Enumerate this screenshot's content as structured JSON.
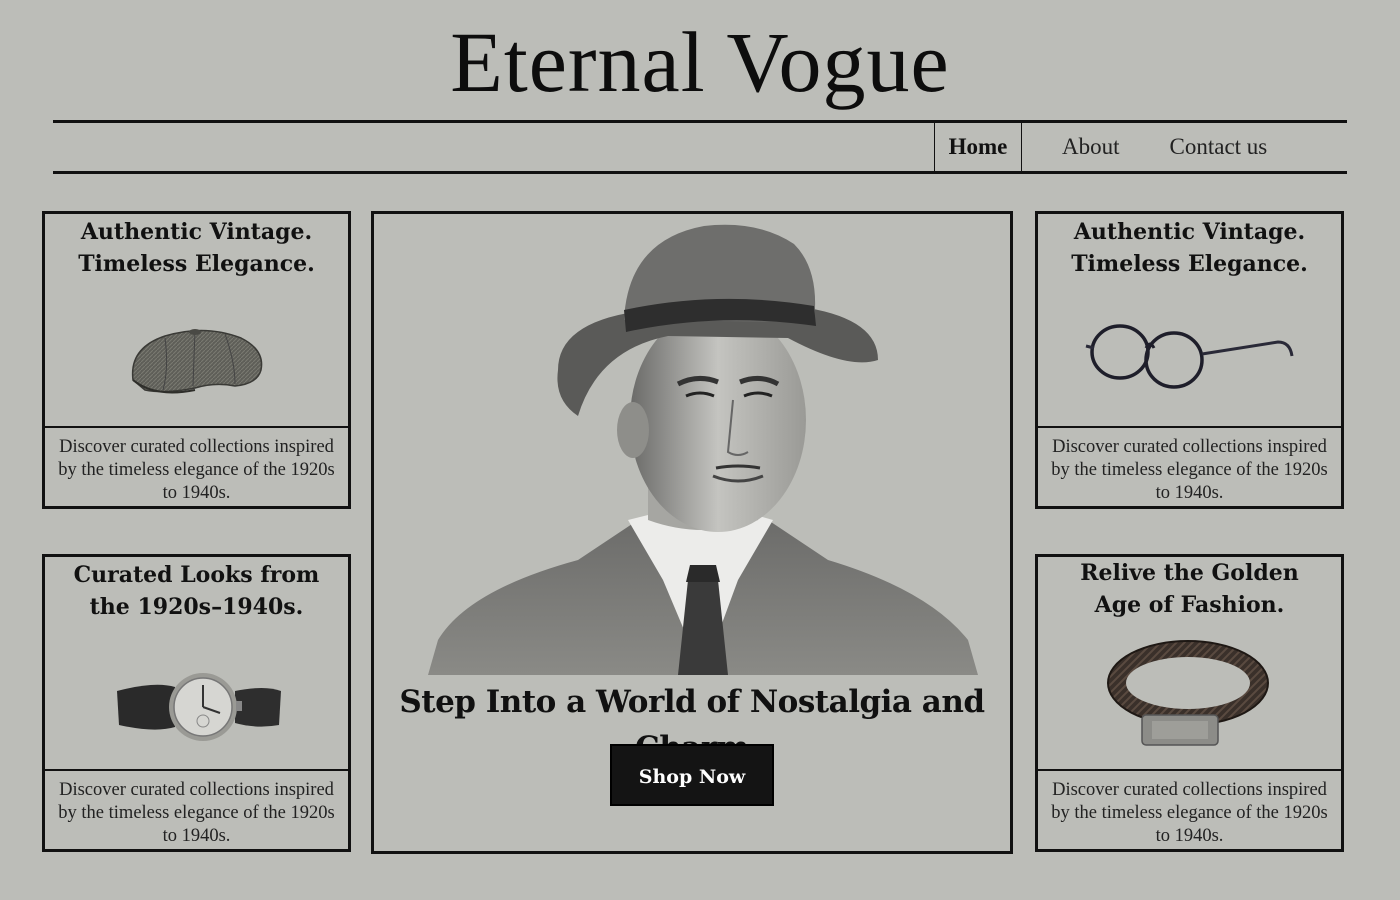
{
  "brand": {
    "title": "Eternal Vogue"
  },
  "nav": {
    "home": "Home",
    "about": "About",
    "contact": "Contact us"
  },
  "cards": [
    {
      "title_line1": "Authentic Vintage.",
      "title_line2": "Timeless Elegance.",
      "image": "tweed-flat-cap",
      "description": "Discover curated collections inspired by the timeless elegance of the 1920s to 1940s."
    },
    {
      "title_line1": "Curated Looks from",
      "title_line2": "the 1920s–1940s.",
      "image": "vintage-wristwatch",
      "description": "Discover curated collections inspired by the timeless elegance of the 1920s to 1940s."
    },
    {
      "title_line1": "Authentic Vintage.",
      "title_line2": "Timeless Elegance.",
      "image": "round-eyeglasses",
      "description": "Discover curated collections inspired by the timeless elegance of the 1920s to 1940s."
    },
    {
      "title_line1": "Relive the Golden",
      "title_line2": "Age of Fashion.",
      "image": "braided-leather-bracelet",
      "description": "Discover curated collections inspired by the timeless elegance of the 1920s to 1940s."
    }
  ],
  "hero": {
    "image": "man-in-fedora-portrait",
    "heading": "Step Into a World of Nostalgia and Charm",
    "button_label": "Shop Now"
  },
  "colors": {
    "background": "#bcbdb8",
    "ink": "#111111",
    "button": "#141414"
  }
}
